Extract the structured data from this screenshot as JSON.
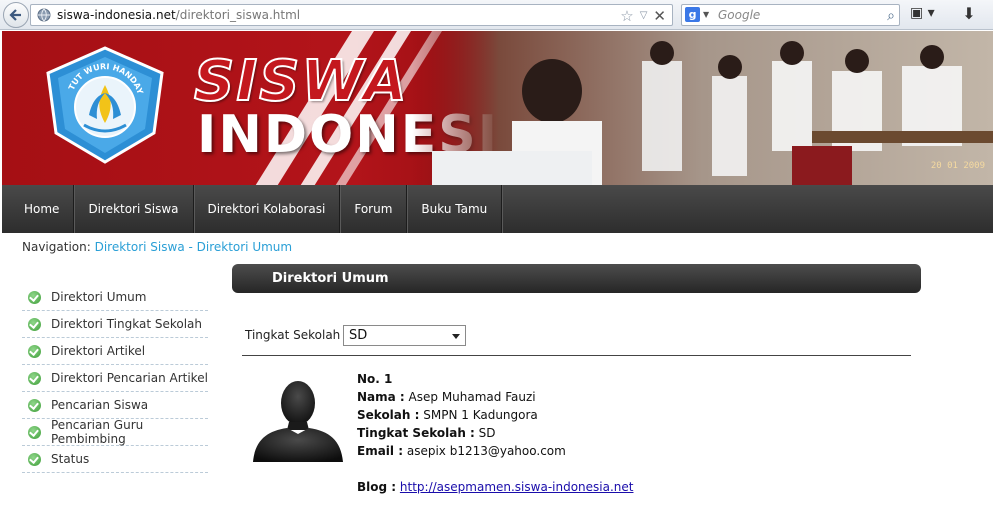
{
  "browser": {
    "url_host": "siswa-indonesia.net",
    "url_path": "/direktori_siswa.html",
    "search_placeholder": "Google"
  },
  "banner": {
    "logo_text": "TUT WURI HANDAYANI",
    "title_line1": "SISWA",
    "title_line2": "INDONESIA",
    "photo_date": "20 01 2009"
  },
  "nav": {
    "items": [
      "Home",
      "Direktori Siswa",
      "Direktori Kolaborasi",
      "Forum",
      "Buku Tamu"
    ]
  },
  "breadcrumb": {
    "label": "Navigation:",
    "path": "Direktori Siswa - Direktori Umum"
  },
  "sidebar": {
    "items": [
      "Direktori Umum",
      "Direktori Tingkat Sekolah",
      "Direktori Artikel",
      "Direktori Pencarian Artikel",
      "Pencarian Siswa",
      "Pencarian Guru Pembimbing",
      "Status"
    ]
  },
  "content": {
    "header": "Direktori Umum",
    "filter_label": "Tingkat Sekolah :",
    "filter_value": "SD",
    "student": {
      "no": "No. 1",
      "nama_label": "Nama :",
      "nama": "Asep Muhamad Fauzi",
      "sekolah_label": "Sekolah :",
      "sekolah": "SMPN 1 Kadungora",
      "tingkat_label": "Tingkat Sekolah :",
      "tingkat": "SD",
      "email_label": "Email :",
      "email": "asepix b1213@yahoo.com",
      "blog_label": "Blog :",
      "blog": "http://asepmamen.siswa-indonesia.net"
    }
  },
  "colors": {
    "banner_red": "#a50f14",
    "nav_dark": "#2d2d2d",
    "link_blue": "#2a9fd6",
    "check_green": "#3f9e3a"
  }
}
